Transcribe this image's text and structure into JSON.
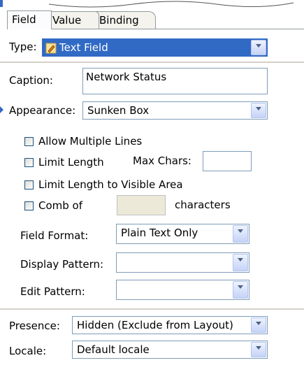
{
  "tabs": [
    {
      "label": "Field"
    },
    {
      "label": "Value"
    },
    {
      "label": "Binding"
    }
  ],
  "type": {
    "label": "Type:",
    "value": "Text Field",
    "icon": "pencil-field-icon"
  },
  "caption": {
    "label": "Caption:",
    "value": "Network Status"
  },
  "appearance": {
    "label": "Appearance:",
    "value": "Sunken Box"
  },
  "options": {
    "allow_multiple_lines": {
      "label": "Allow Multiple Lines",
      "checked": false
    },
    "limit_length": {
      "label": "Limit Length",
      "checked": false
    },
    "max_chars_label": "Max Chars:",
    "max_chars_value": "",
    "limit_visible": {
      "label": "Limit Length to Visible Area",
      "checked": false
    },
    "comb_of": {
      "label": "Comb of",
      "checked": false
    },
    "comb_value": "",
    "characters_label": "characters"
  },
  "field_format": {
    "label": "Field Format:",
    "value": "Plain Text Only"
  },
  "display_pattern": {
    "label": "Display Pattern:",
    "value": ""
  },
  "edit_pattern": {
    "label": "Edit Pattern:",
    "value": ""
  },
  "presence": {
    "label": "Presence:",
    "value": "Hidden (Exclude from Layout)"
  },
  "locale": {
    "label": "Locale:",
    "value": "Default locale"
  },
  "colors": {
    "selection": "#316ac5",
    "border": "#7f9db9"
  }
}
